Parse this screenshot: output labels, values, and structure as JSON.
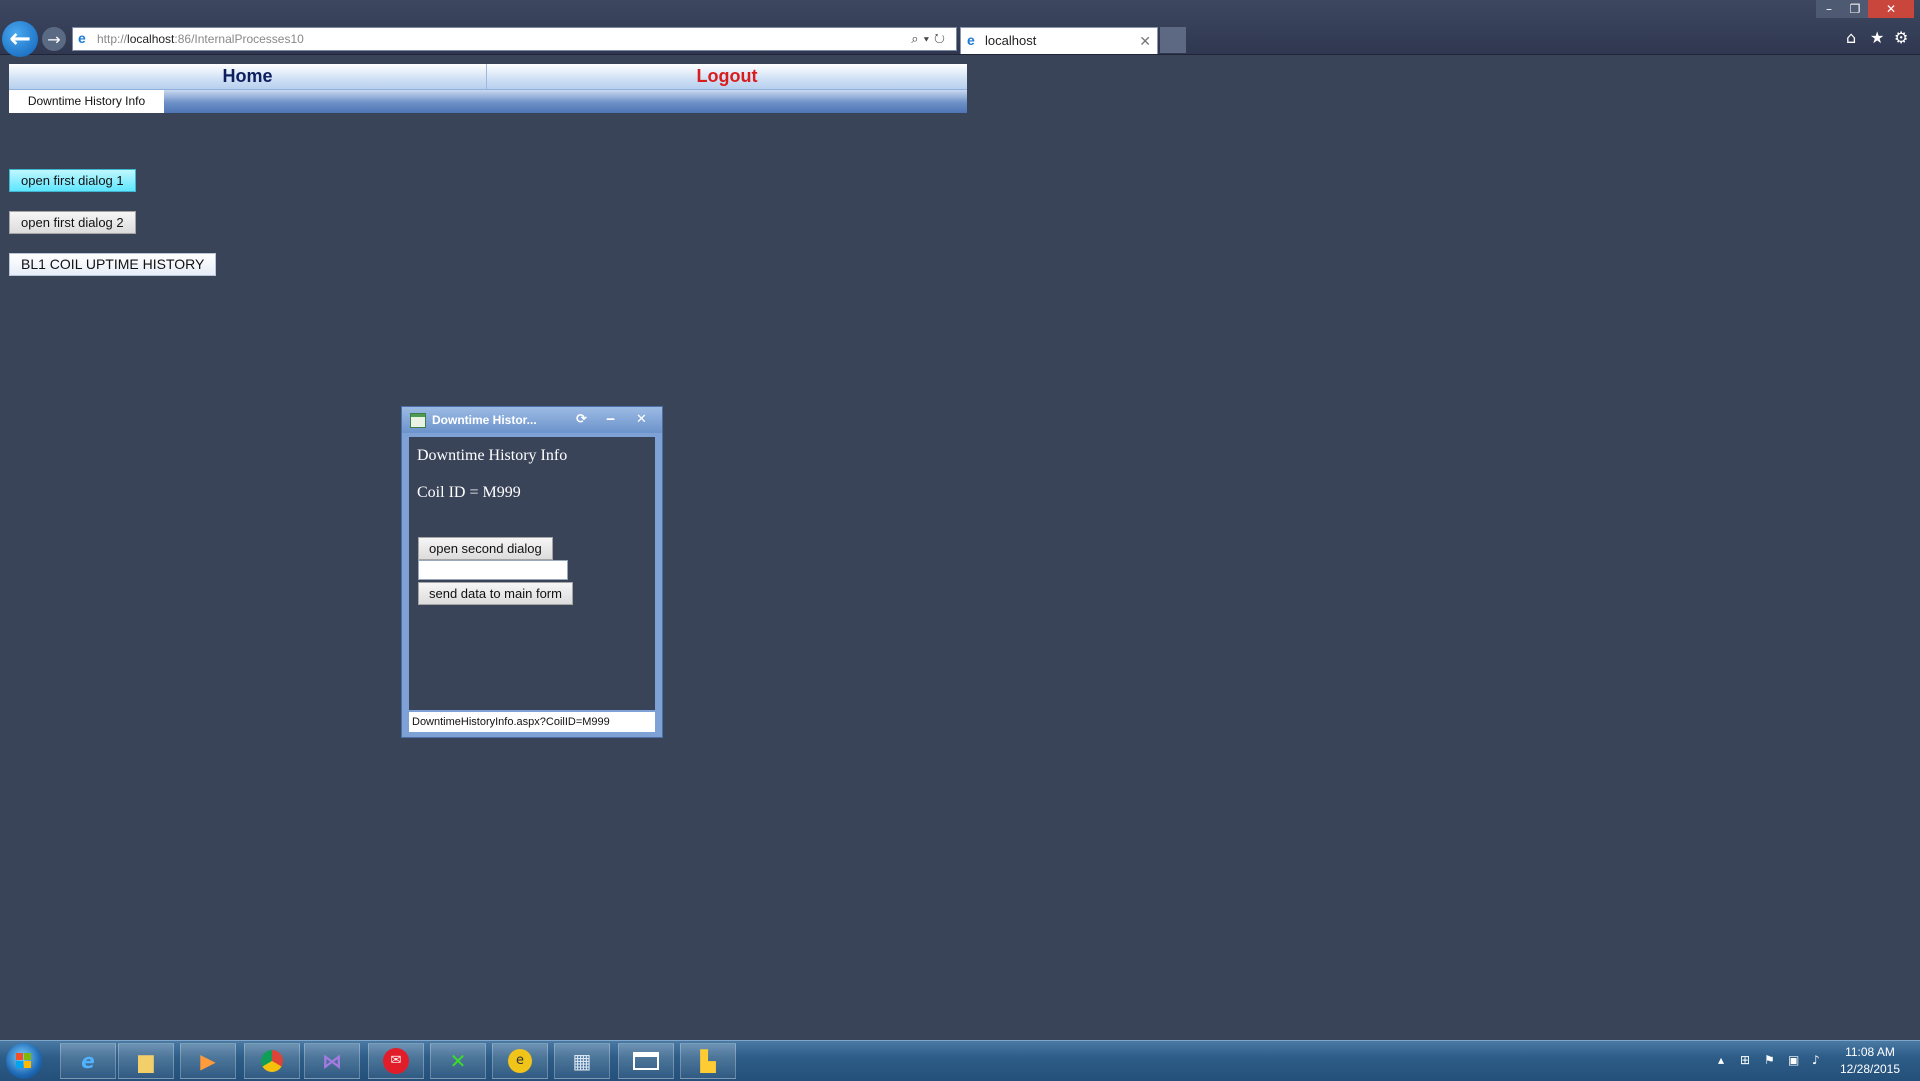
{
  "browser": {
    "address": {
      "prefix": "http://",
      "host": "localhost",
      "rest": ":86/InternalProcesses10",
      "tools": "⌕▾↻"
    },
    "tab": {
      "title": "localhost",
      "close": "✕"
    },
    "window_controls": {
      "min": "–",
      "max": "❐",
      "close": "✕"
    },
    "toolbar_icons": {
      "home": "⌂",
      "favorites": "★",
      "settings": "⚙"
    }
  },
  "page": {
    "menu": {
      "home": "Home",
      "logout": "Logout"
    },
    "submenu": {
      "item": "Downtime History Info"
    },
    "buttons": {
      "dialog1": "open first dialog 1",
      "dialog2": "open first dialog 2",
      "coil_uptime": "BL1 COIL UPTIME HISTORY"
    }
  },
  "dialog": {
    "title": "Downtime Histor...",
    "controls": {
      "refresh": "⟳",
      "minimize": "‒",
      "close": "✕"
    },
    "heading": "Downtime History Info",
    "coil_label": "Coil ID = ",
    "coil_value": "M999",
    "input_value": "",
    "open_second_label": "open second dialog",
    "send_label": "send data to main form",
    "status_text": "DowntimeHistoryInfo.aspx?CoilID=M999"
  },
  "taskbar": {
    "clock_time": "11:08 AM",
    "clock_date": "12/28/2015",
    "tray": {
      "up": "▴",
      "flag": "⚑",
      "network": "▣",
      "volume": "♪"
    }
  },
  "colors": {
    "page_background": "#3a4459",
    "logout_red": "#d81d1d",
    "home_navy": "#0e1f60",
    "dialog1_cyan": "#5fe6ff"
  }
}
